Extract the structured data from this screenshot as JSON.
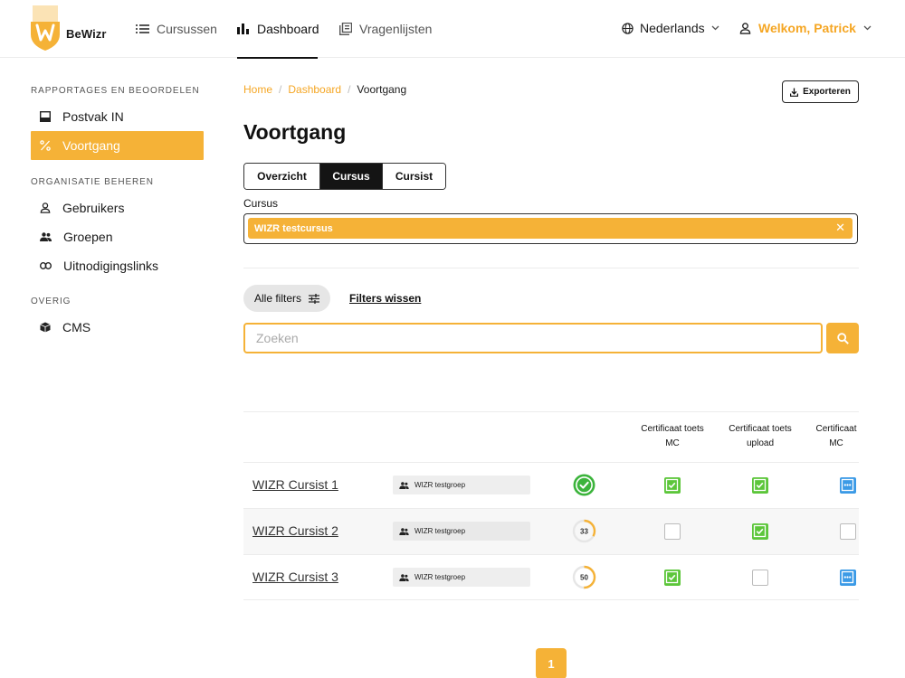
{
  "brand": {
    "name": "BeWizr",
    "accent": "#f5b237"
  },
  "nav": {
    "items": [
      {
        "label": "Cursussen",
        "icon": "list-icon"
      },
      {
        "label": "Dashboard",
        "icon": "bar-chart-icon",
        "active": true
      },
      {
        "label": "Vragenlijsten",
        "icon": "questionnaire-icon"
      }
    ],
    "language": "Nederlands",
    "user_greeting": "Welkom, Patrick"
  },
  "sidebar": {
    "sections": [
      {
        "heading": "RAPPORTAGES EN BEOORDELEN",
        "items": [
          "Postvak IN",
          "Voortgang"
        ]
      },
      {
        "heading": "ORGANISATIE BEHEREN",
        "items": [
          "Gebruikers",
          "Groepen",
          "Uitnodigingslinks"
        ]
      },
      {
        "heading": "OVERIG",
        "items": [
          "CMS"
        ]
      }
    ],
    "active_item": "Voortgang"
  },
  "breadcrumb": [
    "Home",
    "Dashboard",
    "Voortgang"
  ],
  "export_label": "Exporteren",
  "title": "Voortgang",
  "tabs": [
    {
      "label": "Overzicht"
    },
    {
      "label": "Cursus",
      "active": true
    },
    {
      "label": "Cursist"
    }
  ],
  "course_field": {
    "label": "Cursus",
    "selected": "WIZR testcursus"
  },
  "filters": {
    "all_label": "Alle filters",
    "clear_label": "Filters wissen"
  },
  "search": {
    "placeholder": "Zoeken",
    "value": ""
  },
  "table": {
    "columns": [
      "Certificaat toets MC",
      "Certificaat toets upload",
      "Certificaat MC"
    ],
    "rows": [
      {
        "name": "WIZR Cursist 1",
        "group": "WIZR testgroep",
        "progress": 100,
        "progress_label": "",
        "checks": [
          "done",
          "done",
          "partial"
        ]
      },
      {
        "name": "WIZR Cursist 2",
        "group": "WIZR testgroep",
        "progress": 33,
        "progress_label": "33",
        "checks": [
          "empty",
          "done",
          "empty"
        ]
      },
      {
        "name": "WIZR Cursist 3",
        "group": "WIZR testgroep",
        "progress": 50,
        "progress_label": "50",
        "checks": [
          "done",
          "empty",
          "partial"
        ]
      }
    ]
  },
  "pagination": {
    "current": "1"
  }
}
